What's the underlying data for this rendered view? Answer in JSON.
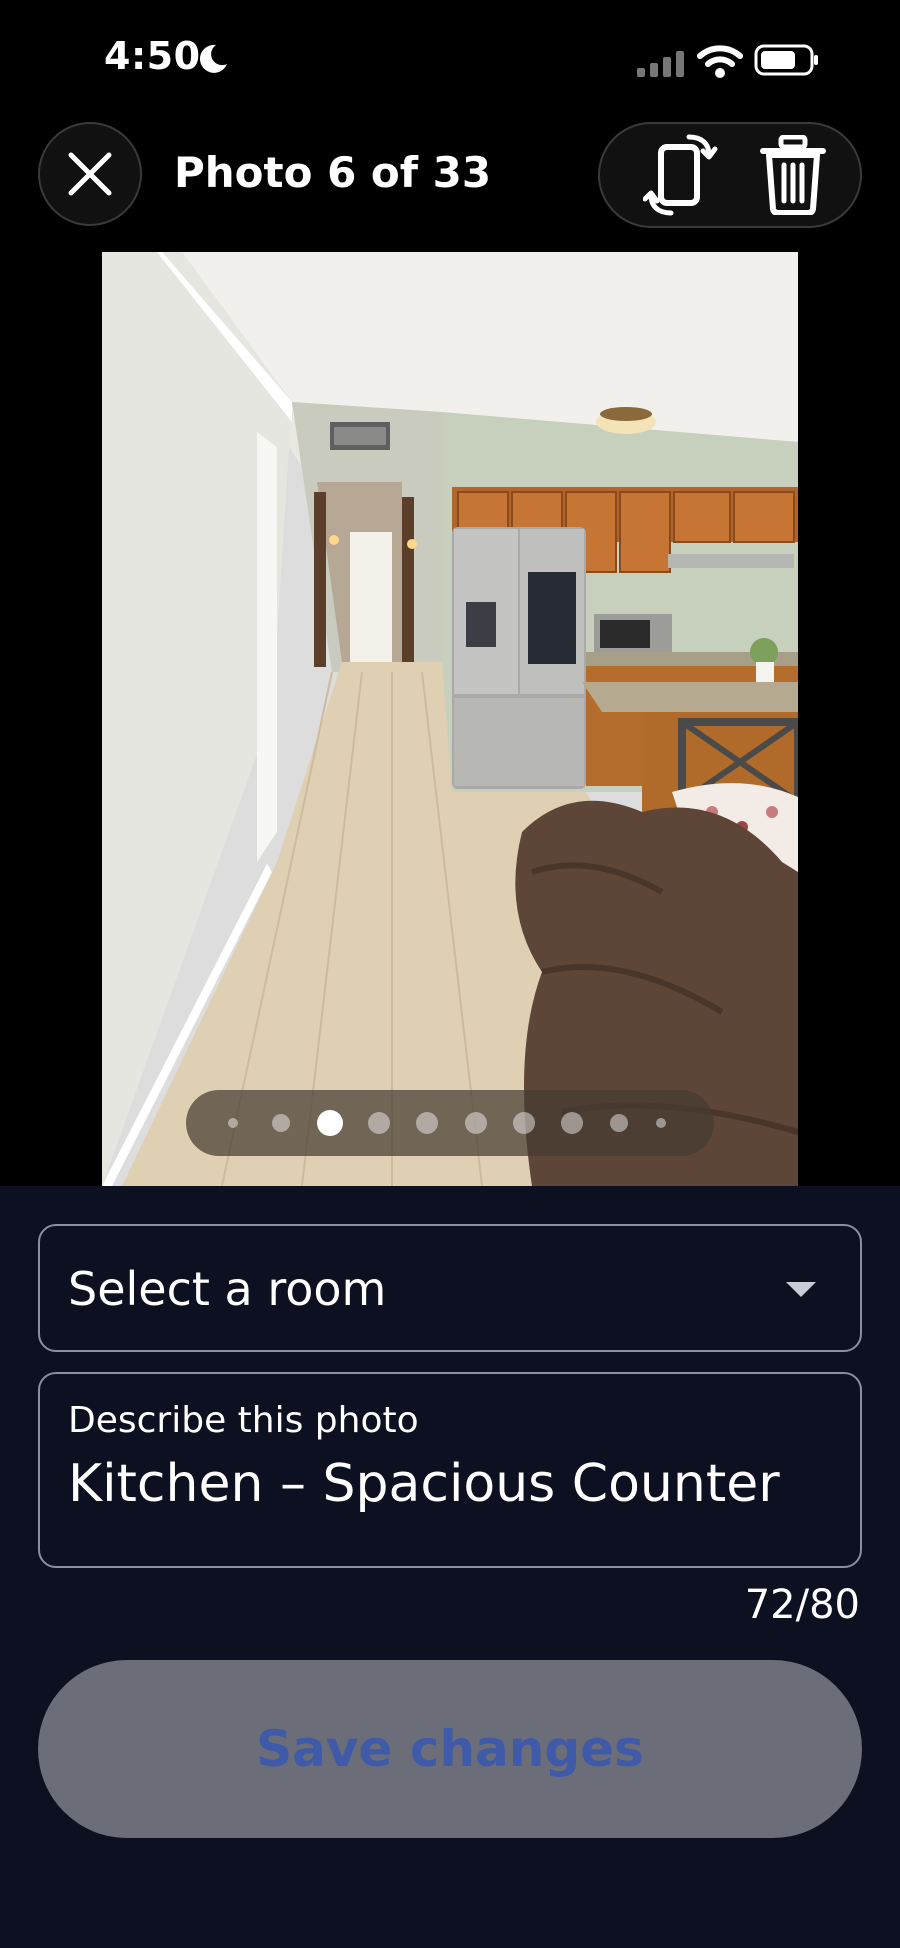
{
  "status_bar": {
    "time": "4:50",
    "icons": [
      "moon-icon",
      "cellular-signal-icon",
      "wifi-icon",
      "battery-icon"
    ]
  },
  "header": {
    "close_icon": "close-icon",
    "title": "Photo 6 of 33",
    "actions": [
      {
        "name": "rotate-photo",
        "icon": "rotate-icon"
      },
      {
        "name": "delete-photo",
        "icon": "trash-icon"
      }
    ]
  },
  "photo": {
    "subject": "interior photo",
    "pager": {
      "dot_count": 10,
      "active_index": 2
    }
  },
  "form": {
    "room_select": {
      "value": "Select a room",
      "icon": "chevron-down-icon"
    },
    "description": {
      "label": "Describe this photo",
      "value": "Kitchen – Spacious Counter",
      "counter": "72/80"
    },
    "save_label": "Save changes"
  },
  "colors": {
    "panel_bg": "#0d1021",
    "save_bg": "#6b6e78",
    "save_text": "#3f5aa8"
  }
}
